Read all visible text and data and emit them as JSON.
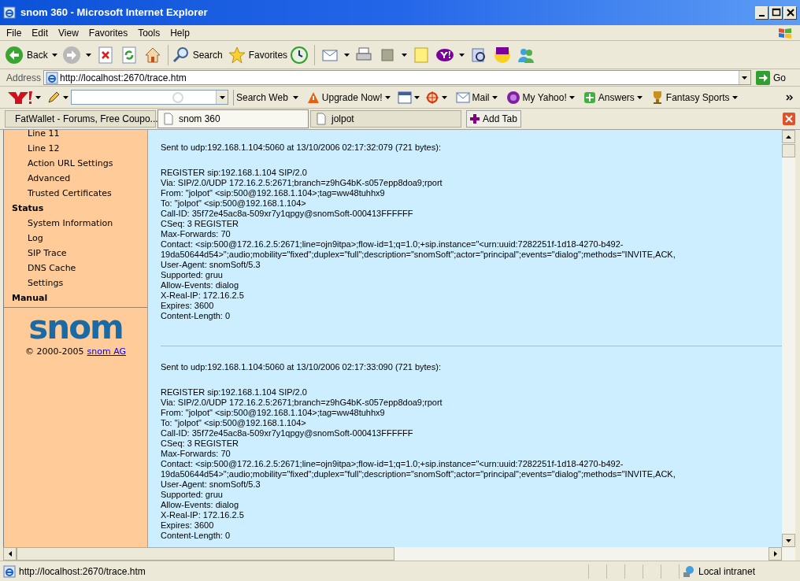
{
  "window": {
    "title": "snom 360 - Microsoft Internet Explorer"
  },
  "menu": [
    "File",
    "Edit",
    "View",
    "Favorites",
    "Tools",
    "Help"
  ],
  "toolbar": {
    "back": "Back",
    "search": "Search",
    "favorites": "Favorites"
  },
  "address": {
    "label": "Address",
    "value": "http://localhost:2670/trace.htm",
    "go": "Go"
  },
  "yahoo_toolbar": {
    "search_button": "Search Web",
    "items": [
      "Upgrade Now!",
      "Mail",
      "My Yahoo!",
      "Answers",
      "Fantasy Sports"
    ]
  },
  "tabs": [
    {
      "label": "FatWallet - Forums, Free Coupo...",
      "selected": false
    },
    {
      "label": "snom 360",
      "selected": true
    },
    {
      "label": "jolpot",
      "selected": false
    }
  ],
  "add_tab": "Add Tab",
  "sidebar": {
    "items": [
      {
        "kind": "link",
        "label": "Line 11"
      },
      {
        "kind": "link",
        "label": "Line 12"
      },
      {
        "kind": "link",
        "label": "Action URL Settings"
      },
      {
        "kind": "link",
        "label": "Advanced"
      },
      {
        "kind": "link",
        "label": "Trusted Certificates"
      },
      {
        "kind": "heading",
        "label": "Status"
      },
      {
        "kind": "link",
        "label": "System Information"
      },
      {
        "kind": "link",
        "label": "Log"
      },
      {
        "kind": "link",
        "label": "SIP Trace"
      },
      {
        "kind": "link",
        "label": "DNS Cache"
      },
      {
        "kind": "link",
        "label": "Settings"
      },
      {
        "kind": "heading",
        "label": "Manual"
      }
    ],
    "logo": "snom",
    "copyright": "© 2000-2005",
    "copyright_link": "snom AG"
  },
  "trace": [
    {
      "header": "Sent to udp:192.168.1.104:5060 at 13/10/2006 02:17:32:079 (721 bytes):",
      "lines": [
        "REGISTER sip:192.168.1.104 SIP/2.0",
        "Via: SIP/2.0/UDP 172.16.2.5:2671;branch=z9hG4bK-s057epp8doa9;rport",
        "From: \"jolpot\" <sip:500@192.168.1.104>;tag=ww48tuhhx9",
        "To: \"jolpot\" <sip:500@192.168.1.104>",
        "Call-ID: 35f72e45ac8a-509xr7y1qpgy@snomSoft-000413FFFFFF",
        "CSeq: 3 REGISTER",
        "Max-Forwards: 70",
        "Contact: <sip:500@172.16.2.5:2671;line=ojn9itpa>;flow-id=1;q=1.0;+sip.instance=\"<urn:uuid:7282251f-1d18-4270-b492-",
        "19da50644d54>\";audio;mobility=\"fixed\";duplex=\"full\";description=\"snomSoft\";actor=\"principal\";events=\"dialog\";methods=\"INVITE,ACK,",
        "User-Agent: snomSoft/5.3",
        "Supported: gruu",
        "Allow-Events: dialog",
        "X-Real-IP: 172.16.2.5",
        "Expires: 3600",
        "Content-Length: 0"
      ]
    },
    {
      "header": "Sent to udp:192.168.1.104:5060 at 13/10/2006 02:17:33:090 (721 bytes):",
      "lines": [
        "REGISTER sip:192.168.1.104 SIP/2.0",
        "Via: SIP/2.0/UDP 172.16.2.5:2671;branch=z9hG4bK-s057epp8doa9;rport",
        "From: \"jolpot\" <sip:500@192.168.1.104>;tag=ww48tuhhx9",
        "To: \"jolpot\" <sip:500@192.168.1.104>",
        "Call-ID: 35f72e45ac8a-509xr7y1qpgy@snomSoft-000413FFFFFF",
        "CSeq: 3 REGISTER",
        "Max-Forwards: 70",
        "Contact: <sip:500@172.16.2.5:2671;line=ojn9itpa>;flow-id=1;q=1.0;+sip.instance=\"<urn:uuid:7282251f-1d18-4270-b492-",
        "19da50644d54>\";audio;mobility=\"fixed\";duplex=\"full\";description=\"snomSoft\";actor=\"principal\";events=\"dialog\";methods=\"INVITE,ACK,",
        "User-Agent: snomSoft/5.3",
        "Supported: gruu",
        "Allow-Events: dialog",
        "X-Real-IP: 172.16.2.5",
        "Expires: 3600",
        "Content-Length: 0"
      ]
    }
  ],
  "status_bar": {
    "url": "http://localhost:2670/trace.htm",
    "zone": "Local intranet"
  }
}
